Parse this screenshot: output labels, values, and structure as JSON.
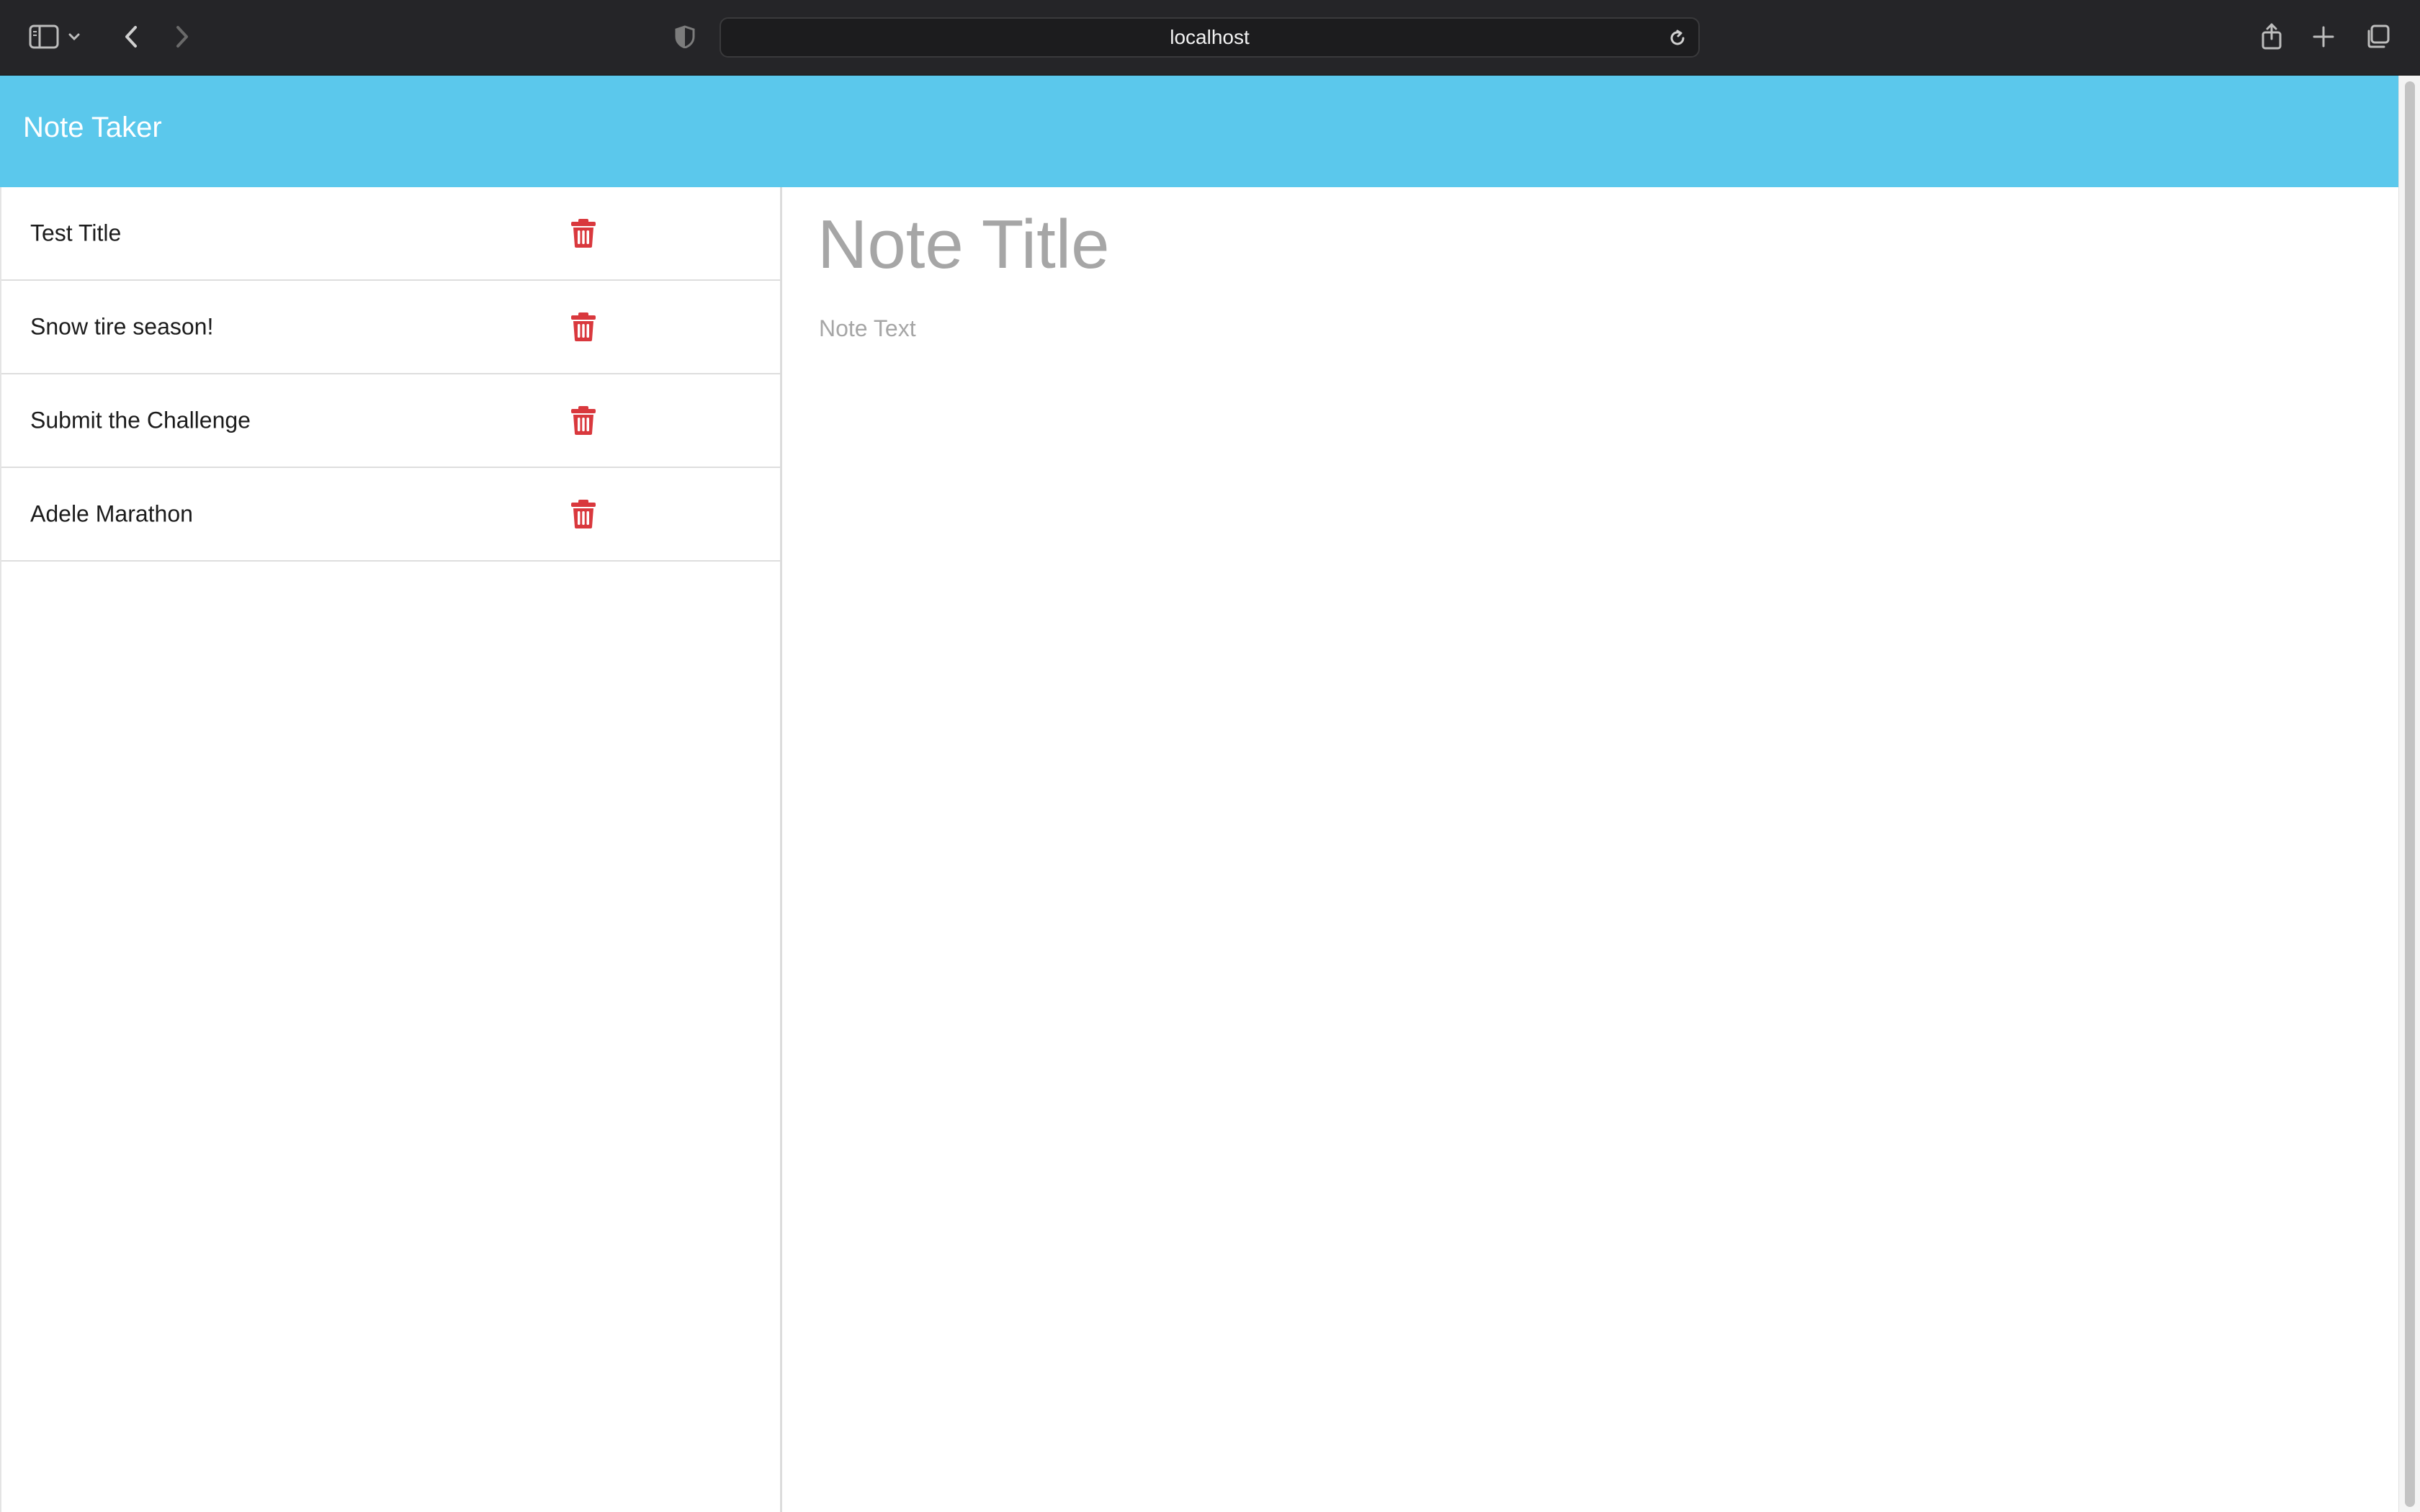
{
  "browser": {
    "url": "localhost",
    "icons": {
      "sidebar": "sidebar-icon",
      "back": "chevron-left-icon",
      "forward": "chevron-right-icon",
      "shield": "shield-icon",
      "reload": "reload-icon",
      "share": "share-icon",
      "new_tab": "plus-icon",
      "tabs": "tabs-overview-icon"
    }
  },
  "app": {
    "brand": "Note Taker",
    "header_color": "#5bc8ec"
  },
  "notes": [
    {
      "title": "Test Title"
    },
    {
      "title": "Snow tire season!"
    },
    {
      "title": "Submit the Challenge"
    },
    {
      "title": "Adele Marathon"
    }
  ],
  "editor": {
    "title_placeholder": "Note Title",
    "text_placeholder": "Note Text"
  },
  "colors": {
    "delete_icon": "#d9383d",
    "placeholder": "#a6a6a6"
  }
}
